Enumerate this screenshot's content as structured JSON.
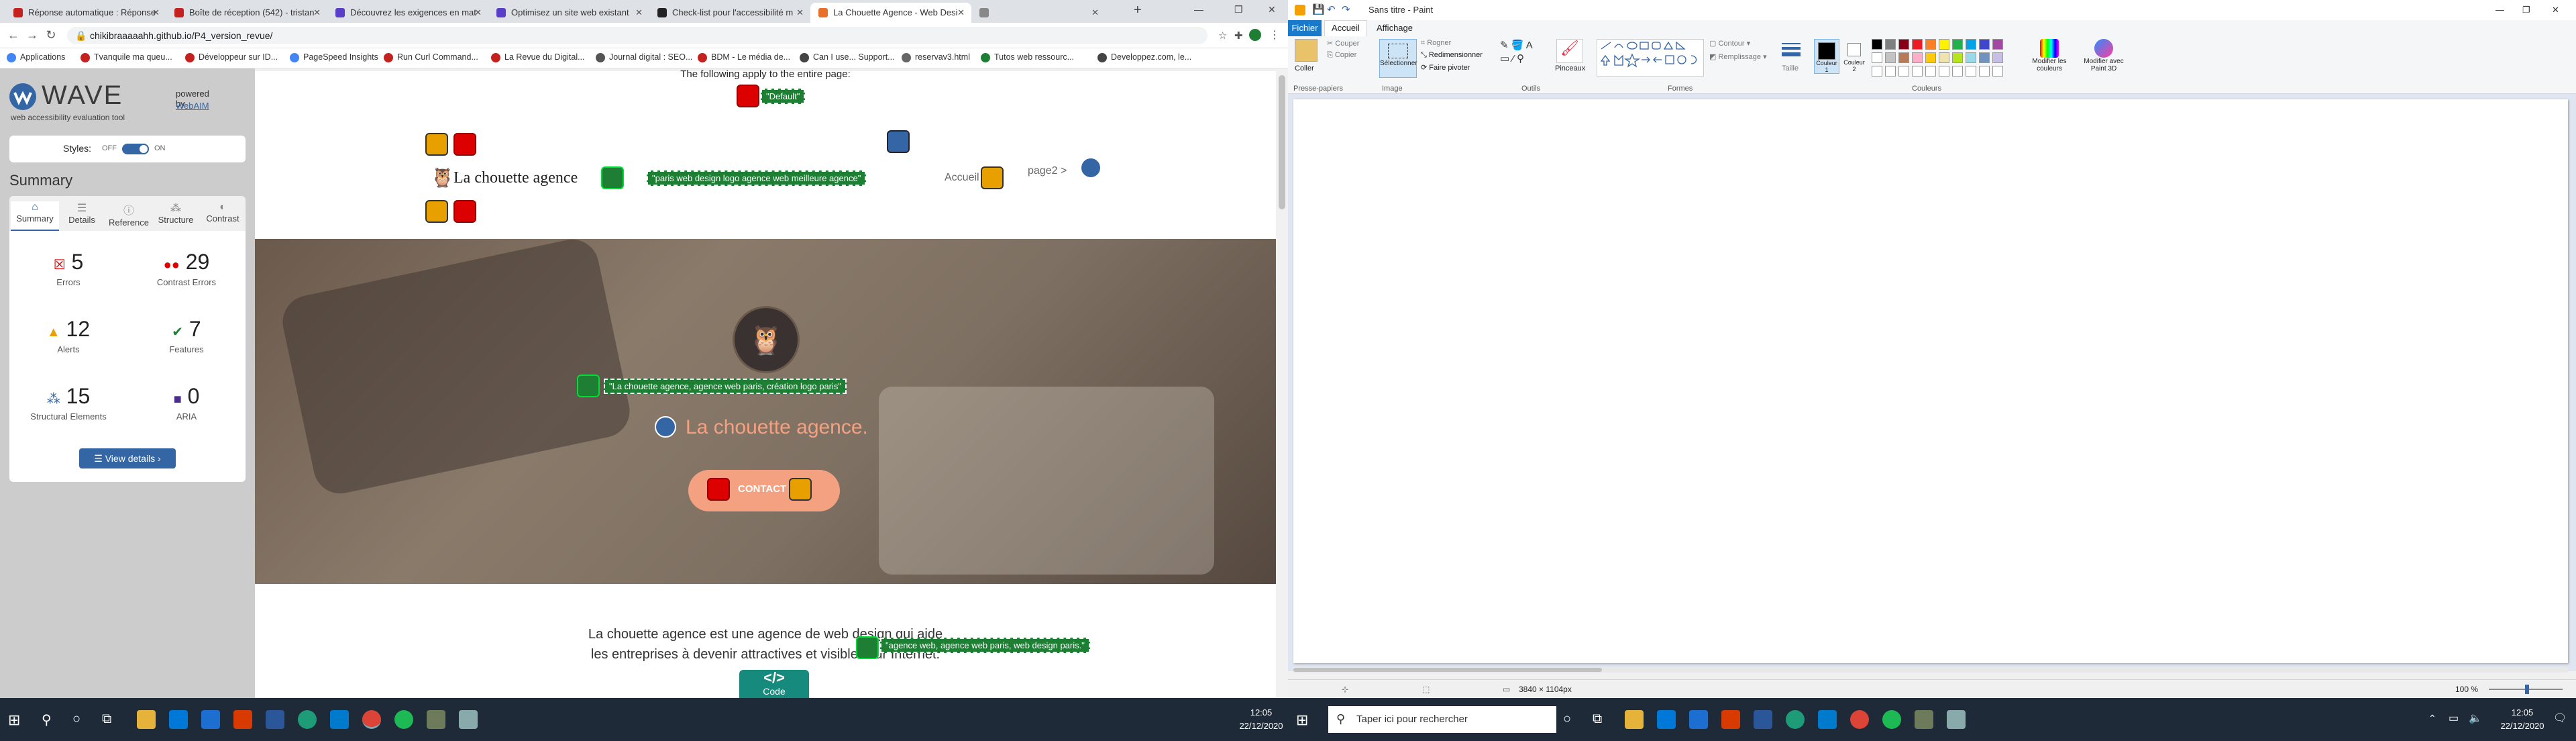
{
  "chrome": {
    "tabs": [
      {
        "label": "Réponse automatique : Réponse",
        "color": "#c5221f"
      },
      {
        "label": "Boîte de réception (542) - tristan",
        "color": "#c5221f"
      },
      {
        "label": "Découvrez les exigences en mat",
        "color": "#5b3ec8"
      },
      {
        "label": "Optimisez un site web existant",
        "color": "#5b3ec8"
      },
      {
        "label": "Check-list pour l'accessibilité m",
        "color": "#222222"
      },
      {
        "label": "La Chouette Agence - Web Desi",
        "color": "#e8702a"
      },
      {
        "label": "",
        "color": "#888888"
      }
    ],
    "url": "chikibraaaaahh.github.io/P4_version_revue/",
    "bookmarks": [
      {
        "label": "Applications",
        "color": "#4285f4"
      },
      {
        "label": "Tvanquile ma queu...",
        "color": "#c5221f"
      },
      {
        "label": "Développeur sur ID...",
        "color": "#c5221f"
      },
      {
        "label": "PageSpeed Insights",
        "color": "#4285f4"
      },
      {
        "label": "Run Curl Command...",
        "color": "#c5221f"
      },
      {
        "label": "La Revue du Digital...",
        "color": "#c5221f"
      },
      {
        "label": "Journal digital : SEO...",
        "color": "#555555"
      },
      {
        "label": "BDM - Le média de...",
        "color": "#c5221f"
      },
      {
        "label": "Can I use... Support...",
        "color": "#444444"
      },
      {
        "label": "reservav3.html",
        "color": "#666666"
      },
      {
        "label": "Tutos web ressourc...",
        "color": "#1e7e34"
      },
      {
        "label": "Developpez.com, le...",
        "color": "#444444"
      }
    ]
  },
  "wave": {
    "title": "WAVE",
    "subtitle": "web accessibility evaluation tool",
    "powered_by": "powered by",
    "webaim": "WebAIM",
    "styles_label": "Styles:",
    "off": "OFF",
    "on": "ON",
    "summary_heading": "Summary",
    "tabs": [
      "Summary",
      "Details",
      "Reference",
      "Structure",
      "Contrast"
    ],
    "stats": [
      {
        "num": "5",
        "label": "Errors"
      },
      {
        "num": "29",
        "label": "Contrast Errors"
      },
      {
        "num": "12",
        "label": "Alerts"
      },
      {
        "num": "7",
        "label": "Features"
      },
      {
        "num": "15",
        "label": "Structural Elements"
      },
      {
        "num": "0",
        "label": "ARIA"
      }
    ],
    "view_details": "View details ›"
  },
  "page": {
    "top_note": "The following apply to the entire page:",
    "default_tag": "\"Default\"",
    "brand": "La chouette agence",
    "alt_logo": "\"paris web design logo agence web meilleure agence\"",
    "nav_home": "Accueil",
    "nav_page2": "page2 >",
    "alt_hero": "\"La chouette agence, agence web paris, création logo paris\"",
    "hero_title": "La chouette agence.",
    "cta": "CONTACT",
    "intro_line1": "La chouette agence est une agence de web design qui aide",
    "intro_line2": "les entreprises à devenir attractives et visibles sur Internet.",
    "alt_intro": "\"agence web, agence web paris, web design paris.\"",
    "code_label": "Code"
  },
  "paint": {
    "title": "Sans titre - Paint",
    "menu": [
      "Fichier",
      "Accueil",
      "Affichage"
    ],
    "groups": [
      "Presse-papiers",
      "Image",
      "Outils",
      "Formes",
      "Couleurs"
    ],
    "buttons": {
      "paste": "Coller",
      "cut": "Couper",
      "copy": "Copier",
      "select": "Sélectionner",
      "crop": "Rogner",
      "resize": "Redimensionner",
      "rotate": "Faire pivoter",
      "brushes": "Pinceaux",
      "outline": "Contour",
      "fill": "Remplissage",
      "size": "Taille",
      "color1": "Couleur 1",
      "color2": "Couleur 2",
      "edit_colors": "Modifier les couleurs",
      "paint3d": "Modifier avec Paint 3D"
    },
    "palette": [
      "#000000",
      "#7f7f7f",
      "#880015",
      "#ed1c24",
      "#ff7f27",
      "#fff200",
      "#22b14c",
      "#00a2e8",
      "#3f48cc",
      "#a349a4",
      "#ffffff",
      "#c3c3c3",
      "#b97a57",
      "#ffaec9",
      "#ffc90e",
      "#efe4b0",
      "#b5e61d",
      "#99d9ea",
      "#7092be",
      "#c8bfe7"
    ],
    "canvas_size": "3840 × 1104px",
    "zoom": "100 %"
  },
  "taskbar": {
    "search_placeholder": "Taper ici pour rechercher",
    "time": "12:05",
    "date": "22/12/2020"
  }
}
